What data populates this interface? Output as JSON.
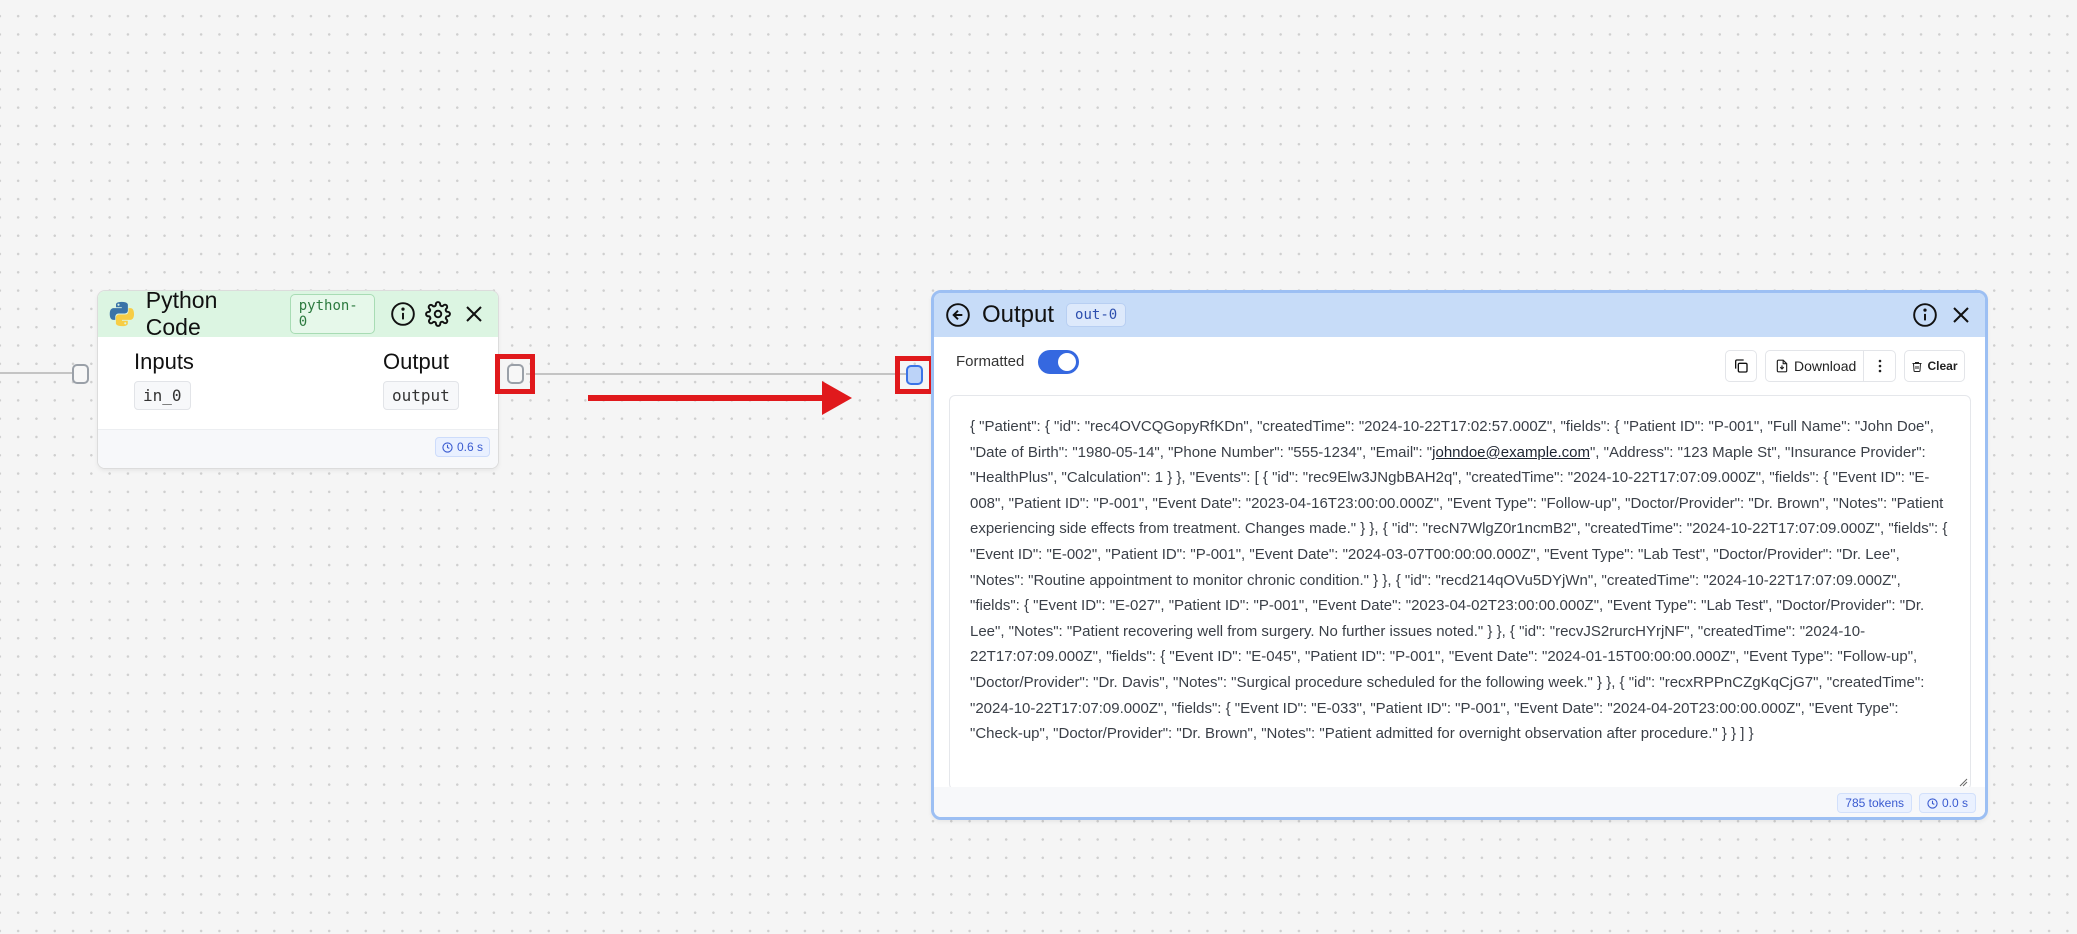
{
  "canvas": {
    "annotation_color": "#e0191c"
  },
  "python_node": {
    "title": "Python Code",
    "id_tag": "python-0",
    "inputs_label": "Inputs",
    "output_label": "Output",
    "input_name": "in_0",
    "output_name": "output",
    "exec_time": "0.6 s",
    "header_color": "#dcf5e2"
  },
  "output_node": {
    "title": "Output",
    "id_tag": "out-0",
    "formatted_label": "Formatted",
    "formatted_on": true,
    "download_label": "Download",
    "clear_label": "Clear",
    "content_before_email": "{ \"Patient\": { \"id\": \"rec4OVCQGopyRfKDn\", \"createdTime\": \"2024-10-22T17:02:57.000Z\", \"fields\": { \"Patient ID\": \"P-001\", \"Full Name\": \"John Doe\", \"Date of Birth\": \"1980-05-14\", \"Phone Number\": \"555-1234\", \"Email\": \"",
    "email": "johndoe@example.com",
    "content_after_email": "\", \"Address\": \"123 Maple St\", \"Insurance Provider\": \"HealthPlus\", \"Calculation\": 1 } }, \"Events\": [ { \"id\": \"rec9Elw3JNgbBAH2q\", \"createdTime\": \"2024-10-22T17:07:09.000Z\", \"fields\": { \"Event ID\": \"E-008\", \"Patient ID\": \"P-001\", \"Event Date\": \"2023-04-16T23:00:00.000Z\", \"Event Type\": \"Follow-up\", \"Doctor/Provider\": \"Dr. Brown\", \"Notes\": \"Patient experiencing side effects from treatment. Changes made.\" } }, { \"id\": \"recN7WlgZ0r1ncmB2\", \"createdTime\": \"2024-10-22T17:07:09.000Z\", \"fields\": { \"Event ID\": \"E-002\", \"Patient ID\": \"P-001\", \"Event Date\": \"2024-03-07T00:00:00.000Z\", \"Event Type\": \"Lab Test\", \"Doctor/Provider\": \"Dr. Lee\", \"Notes\": \"Routine appointment to monitor chronic condition.\" } }, { \"id\": \"recd214qOVu5DYjWn\", \"createdTime\": \"2024-10-22T17:07:09.000Z\", \"fields\": { \"Event ID\": \"E-027\", \"Patient ID\": \"P-001\", \"Event Date\": \"2023-04-02T23:00:00.000Z\", \"Event Type\": \"Lab Test\", \"Doctor/Provider\": \"Dr. Lee\", \"Notes\": \"Patient recovering well from surgery. No further issues noted.\" } }, { \"id\": \"recvJS2rurcHYrjNF\", \"createdTime\": \"2024-10-22T17:07:09.000Z\", \"fields\": { \"Event ID\": \"E-045\", \"Patient ID\": \"P-001\", \"Event Date\": \"2024-01-15T00:00:00.000Z\", \"Event Type\": \"Follow-up\", \"Doctor/Provider\": \"Dr. Davis\", \"Notes\": \"Surgical procedure scheduled for the following week.\" } }, { \"id\": \"recxRPPnCZgKqCjG7\", \"createdTime\": \"2024-10-22T17:07:09.000Z\", \"fields\": { \"Event ID\": \"E-033\", \"Patient ID\": \"P-001\", \"Event Date\": \"2024-04-20T23:00:00.000Z\", \"Event Type\": \"Check-up\", \"Doctor/Provider\": \"Dr. Brown\", \"Notes\": \"Patient admitted for overnight observation after procedure.\" } } ] }",
    "token_count": "785 tokens",
    "exec_time": "0.0 s",
    "header_color": "#c7dcf8",
    "accent_color": "#3568e0"
  }
}
